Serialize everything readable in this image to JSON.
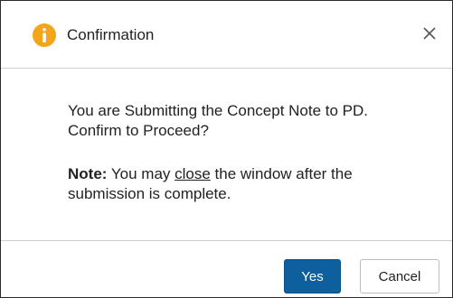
{
  "dialog": {
    "title": "Confirmation",
    "icon": "info-icon",
    "close_icon": "close-icon",
    "message": "You are Submitting the Concept Note to PD. Confirm to Proceed?",
    "note": {
      "label": "Note:",
      "text_before": " You may ",
      "link_text": "close",
      "text_after": " the window after the submission is complete."
    }
  },
  "buttons": {
    "yes_label": "Yes",
    "cancel_label": "Cancel"
  },
  "colors": {
    "info_icon": "#f3a51b",
    "primary_button": "#0e5f9e"
  }
}
